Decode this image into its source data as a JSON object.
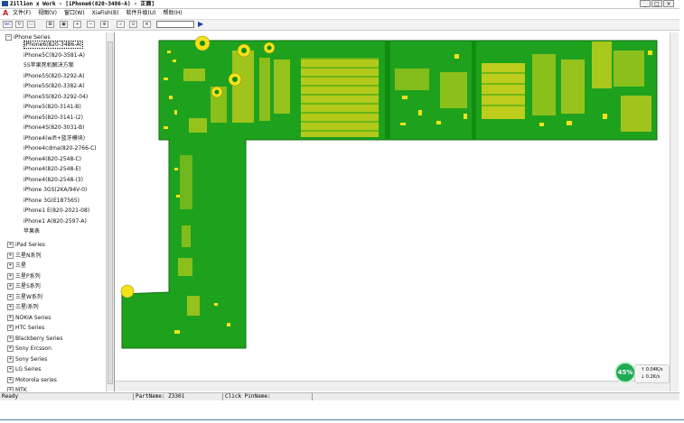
{
  "window": {
    "title": "Zillion x Work - [iPhone6(820-3486-A) - 正面]",
    "controls": [
      "_",
      "□",
      "×"
    ]
  },
  "menu": {
    "mark": "A",
    "items": [
      "文件(F)",
      "视图(V)",
      "窗口(W)",
      "XiaFish(B)",
      "软件升级(U)",
      "帮助(H)"
    ]
  },
  "toolbar": {
    "buttons": [
      "N/C",
      "reload",
      "open",
      "dual-view",
      "fit",
      "zoom-in",
      "zoom-out",
      "zoom-fit",
      "list"
    ],
    "search_value": ""
  },
  "tree": {
    "root": "iPhone Series",
    "children": [
      "iPhone6(820-3486-A)",
      "iPhone5C(820-3581-A)",
      "5S苹果死机解决方案",
      "iPhone5S(820-3292-A)",
      "iPhone5S(820-3382-A)",
      "iPhone5S(820-3292-04)",
      "iPhone5(820-3141-B)",
      "iPhone5(820-3141-(2)",
      "iPhone4S(820-3031-B)",
      "iPhone4(wifi+蓝牙模块)",
      "iPhone4cdma(820-2766-C)",
      "iPhone4(820-2548-C)",
      "iPhone4(820-2548-E)",
      "iPhone4(820-2548-(3)",
      "iPhone 3GS(2KA/94V-0)",
      "iPhone 3G(E187565)",
      "iPhone1 E(820-2021-08)",
      "iPhone1 A(820-2597-A)",
      "苹果表"
    ],
    "groups": [
      "iPad Series",
      "三星N系列",
      "三星",
      "三星P系列",
      "三星S系列",
      "三星W系列",
      "三星i系列",
      "NOKIA Series",
      "HTC Series",
      "Blackberry Series",
      "Sony Ercsson",
      "Sony Series",
      "LG Series",
      "Motorola series",
      "MTK"
    ],
    "selected": "iPhone6(820-3486-A)"
  },
  "statusbar": {
    "ready": "Ready",
    "partname": "PartName: Z3301",
    "pinname": "Click PinName:"
  },
  "speed_widget": {
    "percent": "45%",
    "up": "0.04K/s",
    "down": "0.2K/s"
  },
  "colors": {
    "board_green": "#1ea21e",
    "pad_yellow": "#f2e21a",
    "dark_green": "#118c11"
  }
}
